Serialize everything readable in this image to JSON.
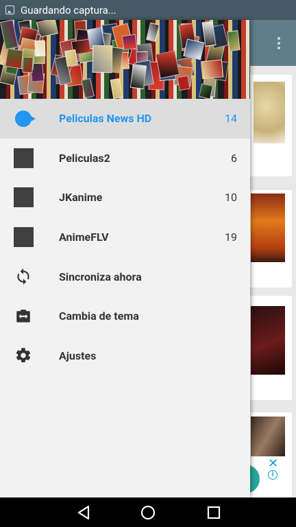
{
  "status_bar": {
    "notification_text": "Guardando captura...",
    "notification_icon": "screenshot-icon"
  },
  "background_app": {
    "toolbar_color": "#607d8b",
    "overflow_icon": "more-vert-icon",
    "ad_close_glyph": "✕",
    "ad_info_glyph": "i"
  },
  "drawer": {
    "header_image": "movie-posters-collage",
    "items": [
      {
        "label": "Peliculas News HD",
        "count": "14",
        "icon": "chat-bubble-icon",
        "active": true
      },
      {
        "label": "Peliculas2",
        "count": "6",
        "icon": "square-icon",
        "active": false
      },
      {
        "label": "JKanime",
        "count": "10",
        "icon": "square-icon",
        "active": false
      },
      {
        "label": "AnimeFLV",
        "count": "19",
        "icon": "square-icon",
        "active": false
      },
      {
        "label": "Sincroniza ahora",
        "count": "",
        "icon": "sync-icon",
        "active": false
      },
      {
        "label": "Cambia de tema",
        "count": "",
        "icon": "theme-icon",
        "active": false
      },
      {
        "label": "Ajustes",
        "count": "",
        "icon": "settings-icon",
        "active": false
      }
    ],
    "accent_color": "#2196f3"
  },
  "nav_bar": {
    "buttons": [
      "back-icon",
      "home-icon",
      "recents-icon"
    ]
  }
}
